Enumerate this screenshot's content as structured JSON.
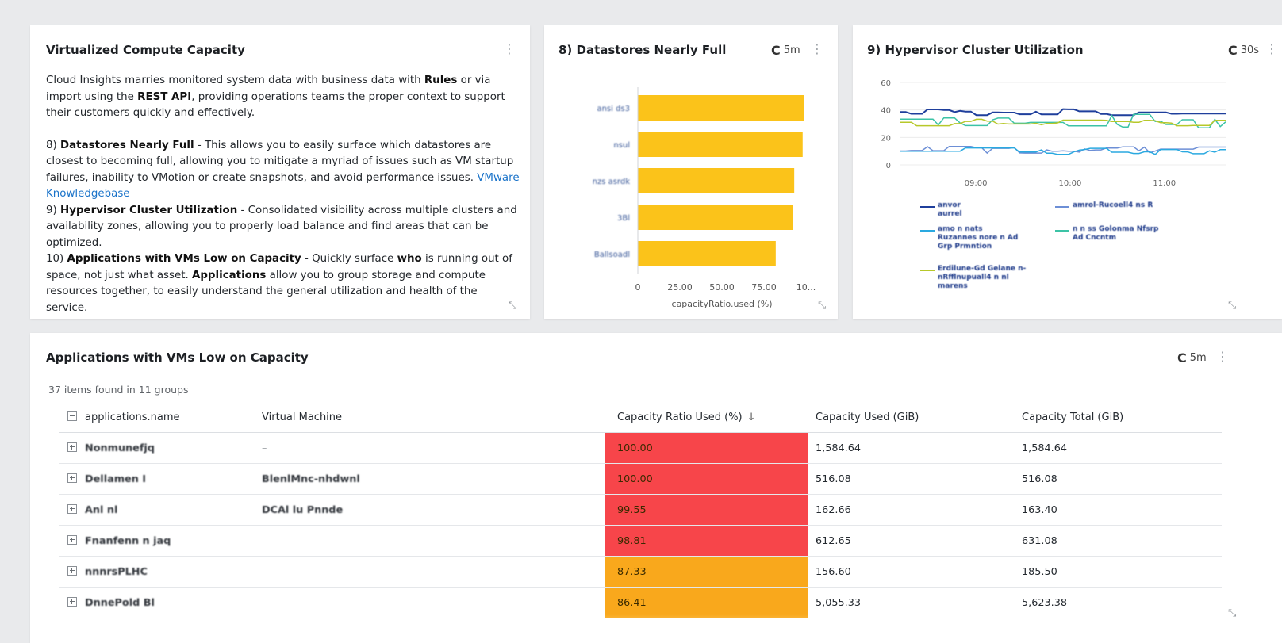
{
  "intro": {
    "title": "Virtualized Compute Capacity",
    "p1_a": "Cloud Insights marries monitored system data with business data with ",
    "p1_b": "Rules",
    "p1_c": " or via import using the ",
    "p1_d": "REST API",
    "p1_e": ", providing operations teams the proper context to support their customers quickly and effectively.",
    "p2_a": "8) ",
    "p2_b": "Datastores Nearly Full",
    "p2_c": " - This allows you to easily surface which datastores are closest to becoming full, allowing you to mitigate a myriad of issues such as VM startup failures, inability to VMotion or create snapshots, and avoid performance issues. ",
    "p2_link": "VMware Knowledgebase",
    "p3_a": "9) ",
    "p3_b": "Hypervisor Cluster Utilization",
    "p3_c": " - Consolidated visibility across multiple clusters and availability zones, allowing you to properly load balance and find areas that can be optimized.",
    "p4_a": "10) ",
    "p4_b": "Applications with VMs Low on Capacity",
    "p4_c": " - Quickly surface ",
    "p4_d": "who",
    "p4_e": " is running out of space, not just what asset. ",
    "p4_f": "Applications",
    "p4_g": " allow you to group storage and compute resources together, to easily understand the general utilization and health of the service."
  },
  "datastores": {
    "title": "8) Datastores Nearly Full",
    "refresh": "5m"
  },
  "hypervisor": {
    "title": "9) Hypervisor Cluster Utilization",
    "refresh": "30s",
    "legend": [
      {
        "label": "anvor aurrel",
        "color": "#1f3f9c"
      },
      {
        "label": "amrol-Rucoell4 ns R",
        "color": "#6d8fd6"
      },
      {
        "label": "amo n nats Ruzannes nore n Ad Grp Prmntion",
        "color": "#2aa9e0"
      },
      {
        "label": "n n ss Golonma Nfsrp Ad Cncntm",
        "color": "#3cc3a6"
      },
      {
        "label": "Erdilune-Gd Gelane n-nRfflnupuall4 n nl marens",
        "color": "#b7c82a"
      }
    ]
  },
  "apps": {
    "title": "Applications with VMs Low on Capacity",
    "refresh": "5m",
    "subtitle": "37 items found in 11 groups",
    "columns": {
      "name": "applications.name",
      "vm": "Virtual Machine",
      "ratio": "Capacity Ratio Used (%)",
      "used": "Capacity Used (GiB)",
      "total": "Capacity Total (GiB)"
    },
    "rows": [
      {
        "name": "Nonmunefjq",
        "vm": "–",
        "ratio": "100.00",
        "used": "1,584.64",
        "total": "1,584.64",
        "color": "#f7454a"
      },
      {
        "name": "Dellamen I",
        "vm": "BlenlMnc-nhdwnl",
        "ratio": "100.00",
        "used": "516.08",
        "total": "516.08",
        "color": "#f7454a"
      },
      {
        "name": "Anl nl",
        "vm": "DCAl lu Pnnde",
        "ratio": "99.55",
        "used": "162.66",
        "total": "163.40",
        "color": "#f7454a"
      },
      {
        "name": "Fnanfenn n jaq",
        "vm": "",
        "ratio": "98.81",
        "used": "612.65",
        "total": "631.08",
        "color": "#f7454a"
      },
      {
        "name": "nnnrsPLHC",
        "vm": "–",
        "ratio": "87.33",
        "used": "156.60",
        "total": "185.50",
        "color": "#f9a81c"
      },
      {
        "name": "DnnePold Bl",
        "vm": "–",
        "ratio": "86.41",
        "used": "5,055.33",
        "total": "5,623.38",
        "color": "#f9a81c"
      }
    ]
  },
  "chart_data": [
    {
      "type": "bar",
      "orientation": "horizontal",
      "title": "8) Datastores Nearly Full",
      "categories": [
        "ansi ds3",
        "nsul",
        "nzs asrdk",
        "3Bl",
        "Ballsoadl"
      ],
      "values": [
        99,
        98,
        93,
        92,
        82
      ],
      "xlabel": "capacityRatio.used (%)",
      "xticks": [
        "0",
        "25.00",
        "50.00",
        "75.00",
        "10..."
      ],
      "xlim": [
        0,
        100
      ],
      "bar_color": "#fbc31a",
      "grid": false
    },
    {
      "type": "line",
      "title": "9) Hypervisor Cluster Utilization",
      "ylim": [
        0,
        60
      ],
      "yticks": [
        "0",
        "20",
        "40",
        "60"
      ],
      "xticks": [
        "09:00",
        "10:00",
        "11:00"
      ],
      "x_range_hours": [
        8.2,
        11.65
      ],
      "grid": true,
      "series_colors": [
        "#1f3f9c",
        "#6d8fd6",
        "#2aa9e0",
        "#3cc3a6",
        "#b7c82a"
      ],
      "series_levels": [
        38.5,
        11,
        10,
        32,
        31
      ]
    }
  ]
}
